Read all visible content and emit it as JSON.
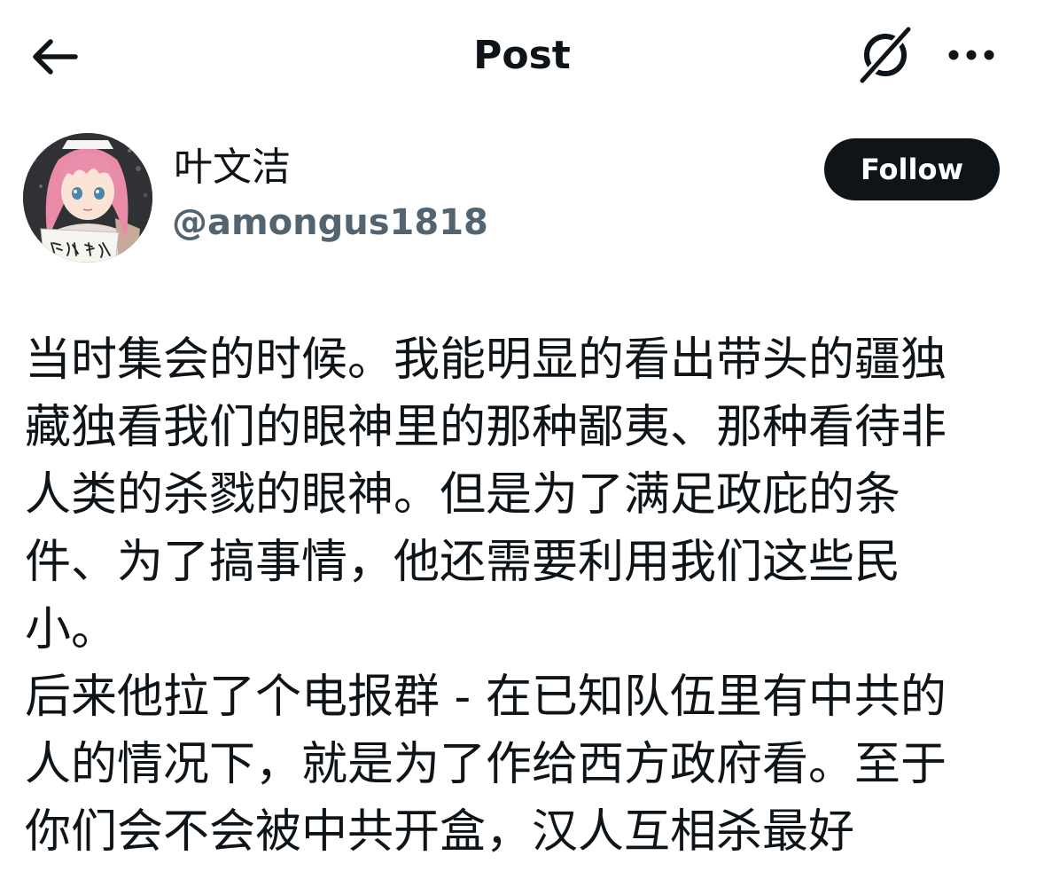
{
  "header": {
    "title": "Post",
    "back_icon": "arrow-left-icon",
    "grok_icon": "grok-icon",
    "more_icon": "more-horizontal-icon"
  },
  "author": {
    "name": "叶文洁",
    "handle": "@amongus1818",
    "avatar_sign_text": "阶级敌人"
  },
  "follow_button": {
    "label": "Follow"
  },
  "post": {
    "lines": [
      "当时集会的时候。我能明显的看出带头的疆独",
      "藏独看我们的眼神里的那种鄙夷、那种看待非",
      "人类的杀戮的眼神。但是为了满足政庇的条",
      "件、为了搞事情，他还需要利用我们这些民",
      "小。",
      "后来他拉了个电报群 - 在已知队伍里有中共的",
      "人的情况下，就是为了作给西方政府看。至于",
      "你们会不会被中共开盒，汉人互相杀最好"
    ]
  },
  "colors": {
    "text_primary": "#0f1419",
    "text_secondary": "#536471",
    "button_bg": "#0f1419",
    "button_text": "#ffffff",
    "background": "#ffffff"
  }
}
